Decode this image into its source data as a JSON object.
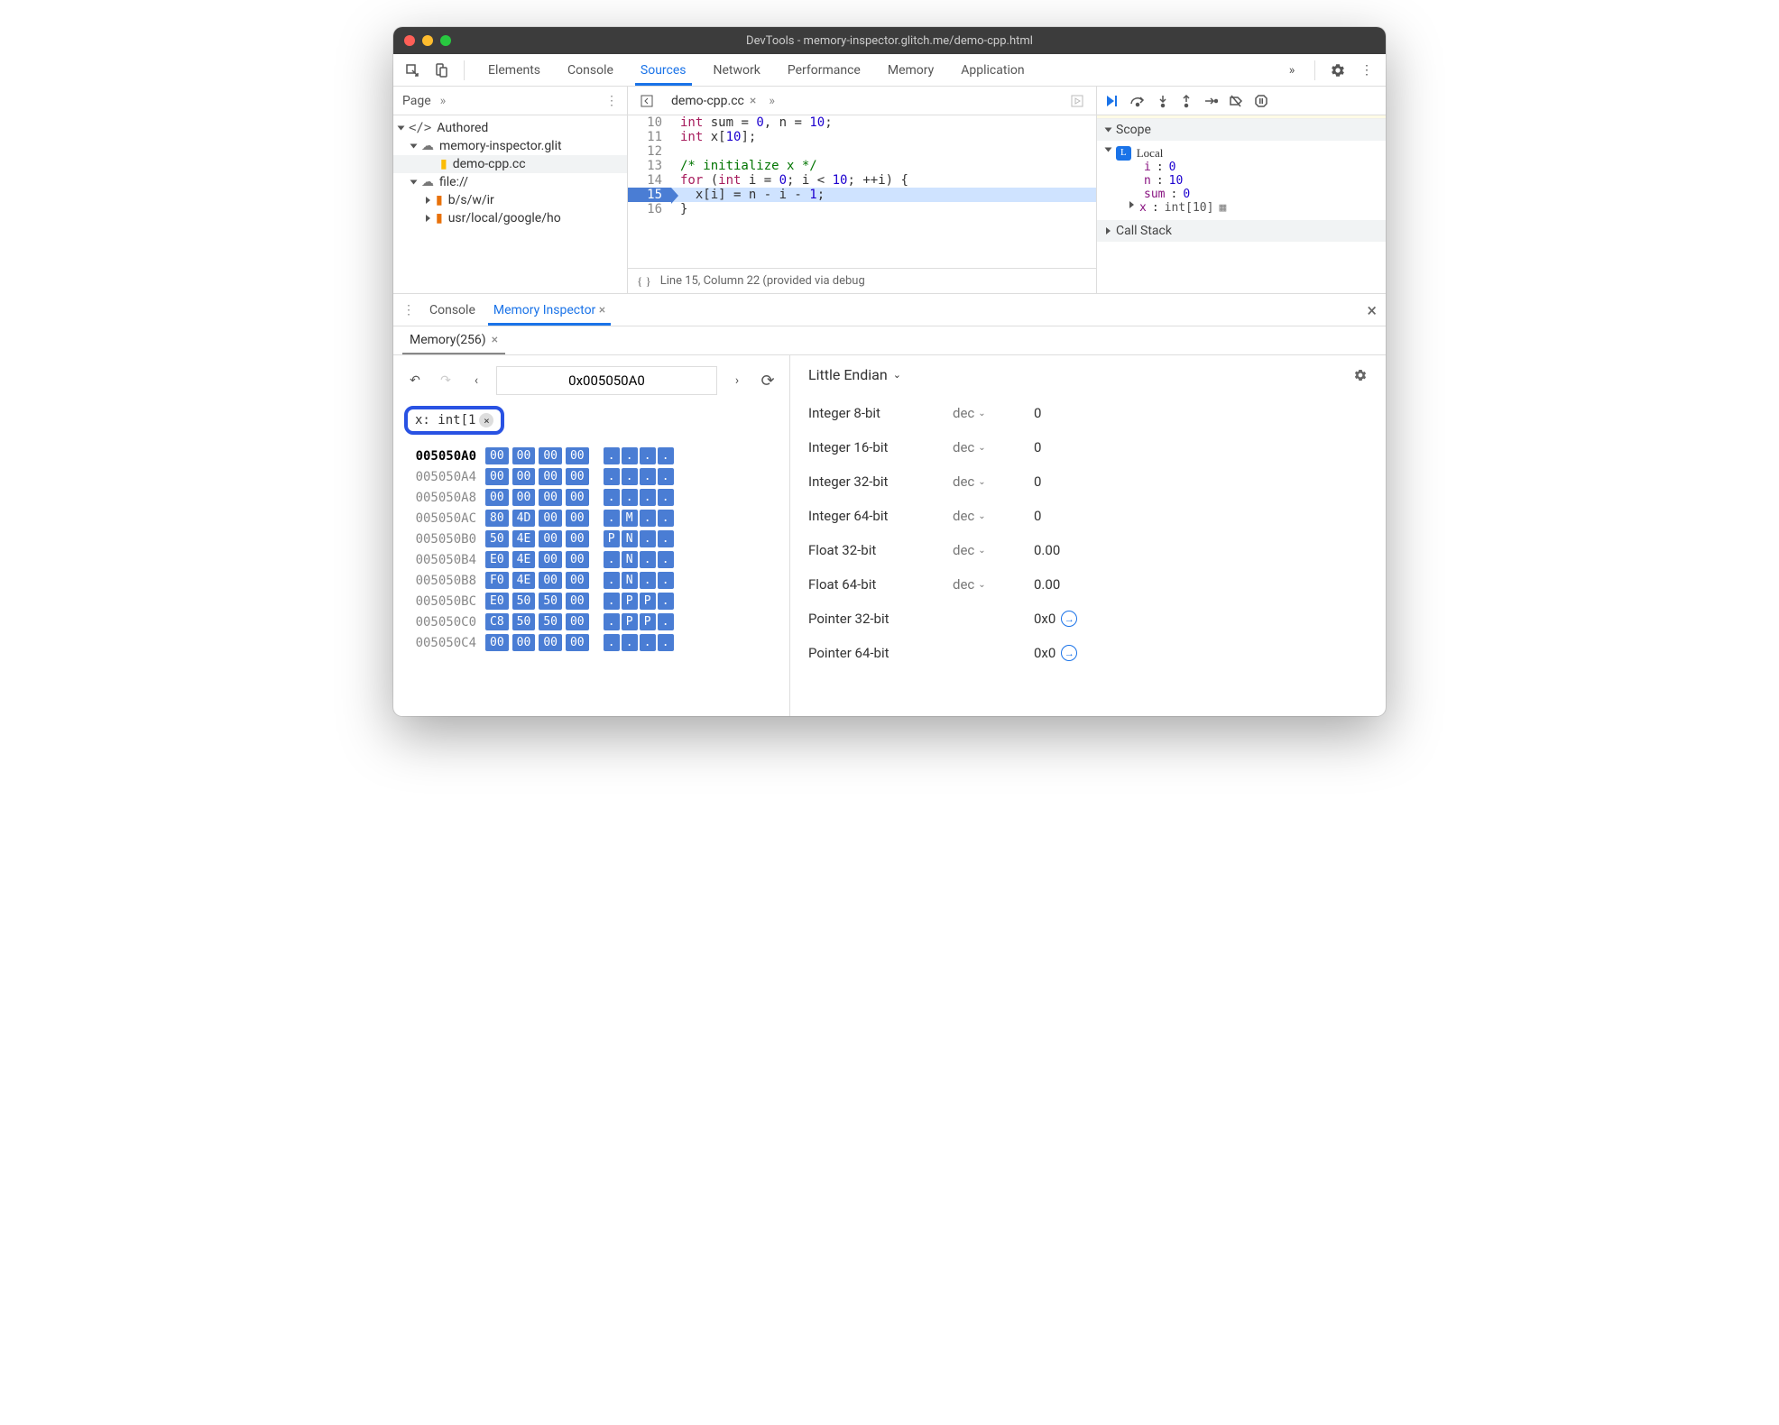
{
  "window_title": "DevTools - memory-inspector.glitch.me/demo-cpp.html",
  "main_tabs": [
    "Elements",
    "Console",
    "Sources",
    "Network",
    "Performance",
    "Memory",
    "Application"
  ],
  "main_tabs_active": "Sources",
  "sidebar": {
    "head_label": "Page",
    "tree": {
      "authored": "Authored",
      "domain": "memory-inspector.glit",
      "file": "demo-cpp.cc",
      "fileroot": "file://",
      "path1": "b/s/w/ir",
      "path2": "usr/local/google/ho"
    }
  },
  "editor": {
    "tab": "demo-cpp.cc",
    "lines": [
      {
        "n": "10",
        "html": "<span class='kw'>int</span> sum = <span class='num'>0</span>, n = <span class='num'>10</span>;"
      },
      {
        "n": "11",
        "html": "<span class='kw'>int</span> x[<span class='num'>10</span>];"
      },
      {
        "n": "12",
        "html": ""
      },
      {
        "n": "13",
        "html": "<span class='cm'>/* initialize x */</span>"
      },
      {
        "n": "14",
        "html": "<span class='kw'>for</span> (<span class='kw'>int</span> i = <span class='num'>0</span>; i &lt; <span class='num'>10</span>; ++i) {"
      },
      {
        "n": "15",
        "html": "  x[i] = n - i - <span class='num'>1</span>;",
        "hl": true
      },
      {
        "n": "16",
        "html": "}"
      }
    ],
    "footer": "Line 15, Column 22 (provided via debug"
  },
  "scope": {
    "header": "Scope",
    "local": "Local",
    "vars": [
      {
        "k": "i",
        "v": "0"
      },
      {
        "k": "n",
        "v": "10"
      },
      {
        "k": "sum",
        "v": "0"
      },
      {
        "k": "x",
        "t": "int[10]"
      }
    ],
    "callstack": "Call Stack"
  },
  "drawer": {
    "tabs": [
      "Console",
      "Memory Inspector"
    ],
    "active": "Memory Inspector",
    "memtab": "Memory(256)"
  },
  "memory": {
    "address": "0x005050A0",
    "chip": "x: int[1",
    "endian": "Little Endian",
    "rows": [
      {
        "addr": "005050A0",
        "b": [
          "00",
          "00",
          "00",
          "00"
        ],
        "a": [
          ".",
          ".",
          ".",
          "."
        ]
      },
      {
        "addr": "005050A4",
        "b": [
          "00",
          "00",
          "00",
          "00"
        ],
        "a": [
          ".",
          ".",
          ".",
          "."
        ]
      },
      {
        "addr": "005050A8",
        "b": [
          "00",
          "00",
          "00",
          "00"
        ],
        "a": [
          ".",
          ".",
          ".",
          "."
        ]
      },
      {
        "addr": "005050AC",
        "b": [
          "80",
          "4D",
          "00",
          "00"
        ],
        "a": [
          ".",
          "M",
          ".",
          "."
        ]
      },
      {
        "addr": "005050B0",
        "b": [
          "50",
          "4E",
          "00",
          "00"
        ],
        "a": [
          "P",
          "N",
          ".",
          "."
        ]
      },
      {
        "addr": "005050B4",
        "b": [
          "E0",
          "4E",
          "00",
          "00"
        ],
        "a": [
          ".",
          "N",
          ".",
          "."
        ]
      },
      {
        "addr": "005050B8",
        "b": [
          "F0",
          "4E",
          "00",
          "00"
        ],
        "a": [
          ".",
          "N",
          ".",
          "."
        ]
      },
      {
        "addr": "005050BC",
        "b": [
          "E0",
          "50",
          "50",
          "00"
        ],
        "a": [
          ".",
          "P",
          "P",
          "."
        ]
      },
      {
        "addr": "005050C0",
        "b": [
          "C8",
          "50",
          "50",
          "00"
        ],
        "a": [
          ".",
          "P",
          "P",
          "."
        ]
      },
      {
        "addr": "005050C4",
        "b": [
          "00",
          "00",
          "00",
          "00"
        ],
        "a": [
          ".",
          ".",
          ".",
          "."
        ]
      }
    ],
    "values": [
      {
        "label": "Integer 8-bit",
        "fmt": "dec",
        "val": "0"
      },
      {
        "label": "Integer 16-bit",
        "fmt": "dec",
        "val": "0"
      },
      {
        "label": "Integer 32-bit",
        "fmt": "dec",
        "val": "0"
      },
      {
        "label": "Integer 64-bit",
        "fmt": "dec",
        "val": "0"
      },
      {
        "label": "Float 32-bit",
        "fmt": "dec",
        "val": "0.00"
      },
      {
        "label": "Float 64-bit",
        "fmt": "dec",
        "val": "0.00"
      },
      {
        "label": "Pointer 32-bit",
        "fmt": "",
        "val": "0x0",
        "jump": true
      },
      {
        "label": "Pointer 64-bit",
        "fmt": "",
        "val": "0x0",
        "jump": true
      }
    ]
  }
}
